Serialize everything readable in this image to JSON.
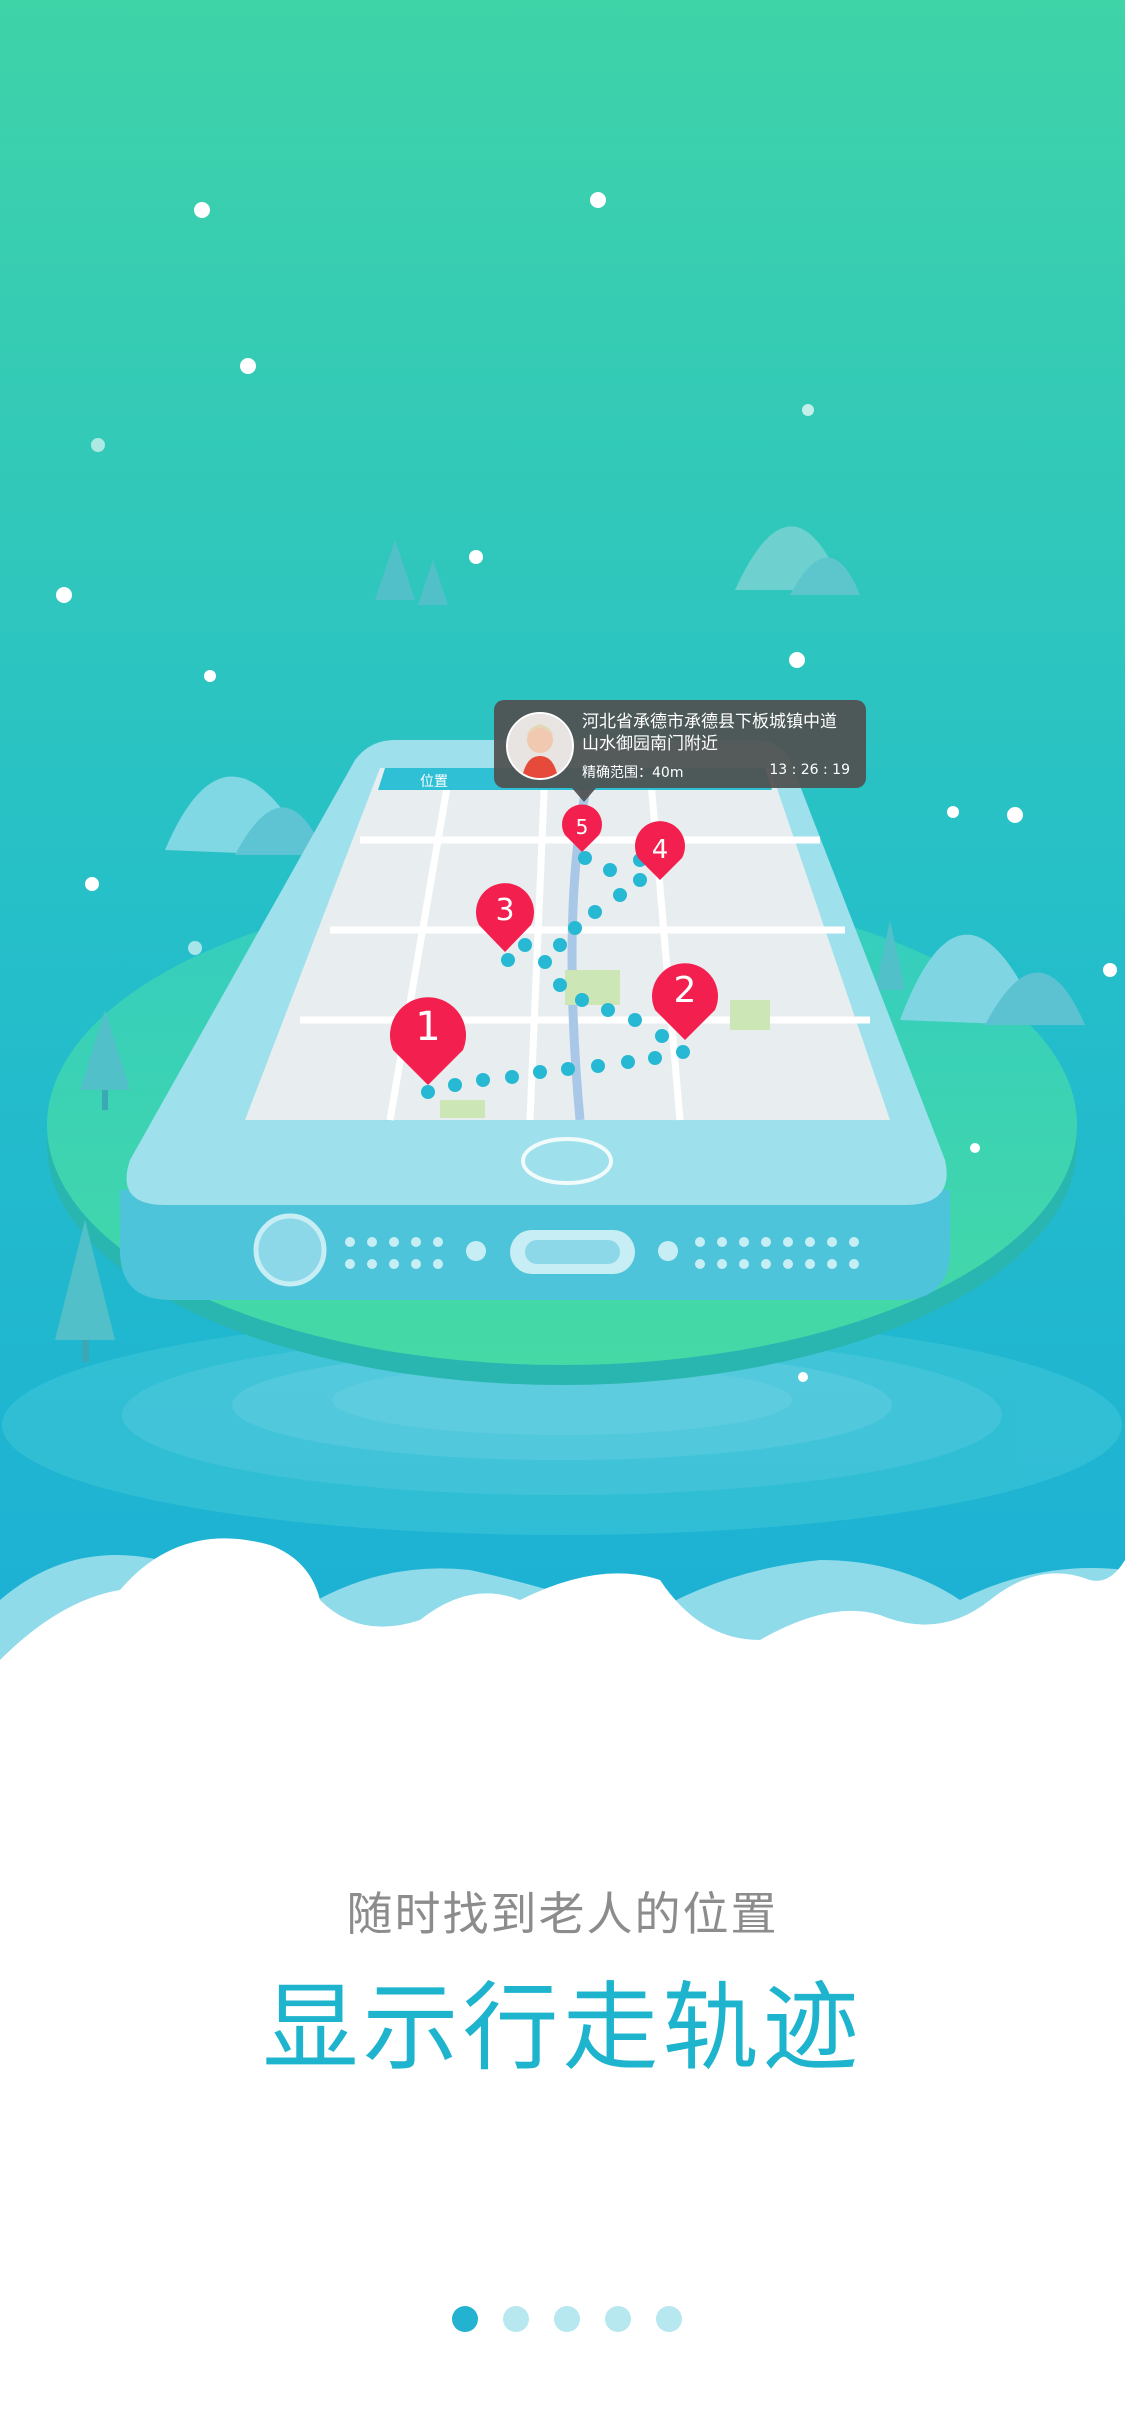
{
  "tooltip": {
    "address_line1": "河北省承德市承德县下板城镇中道",
    "address_line2": "山水御园南门附近",
    "accuracy": "精确范围：40m",
    "time": "13 : 26 : 19"
  },
  "map_pins": [
    {
      "label": "1"
    },
    {
      "label": "2"
    },
    {
      "label": "3"
    },
    {
      "label": "4"
    },
    {
      "label": "5"
    }
  ],
  "phone_header_title": "位置",
  "subtitle": "随时找到老人的位置",
  "title": "显示行走轨迹",
  "pagination": {
    "count": 5,
    "active_index": 0
  },
  "colors": {
    "sky_top": "#3fd3a8",
    "sky_bottom": "#1fb2d3",
    "island": "#41d8b8",
    "phone": "#8fdbea",
    "pin": "#f3204f",
    "trail": "#27b9d3",
    "title": "#1eb4cd",
    "subtitle": "#8c8c8c",
    "dot_active": "#23b3d0",
    "dot_inactive": "#b7e7ef"
  }
}
